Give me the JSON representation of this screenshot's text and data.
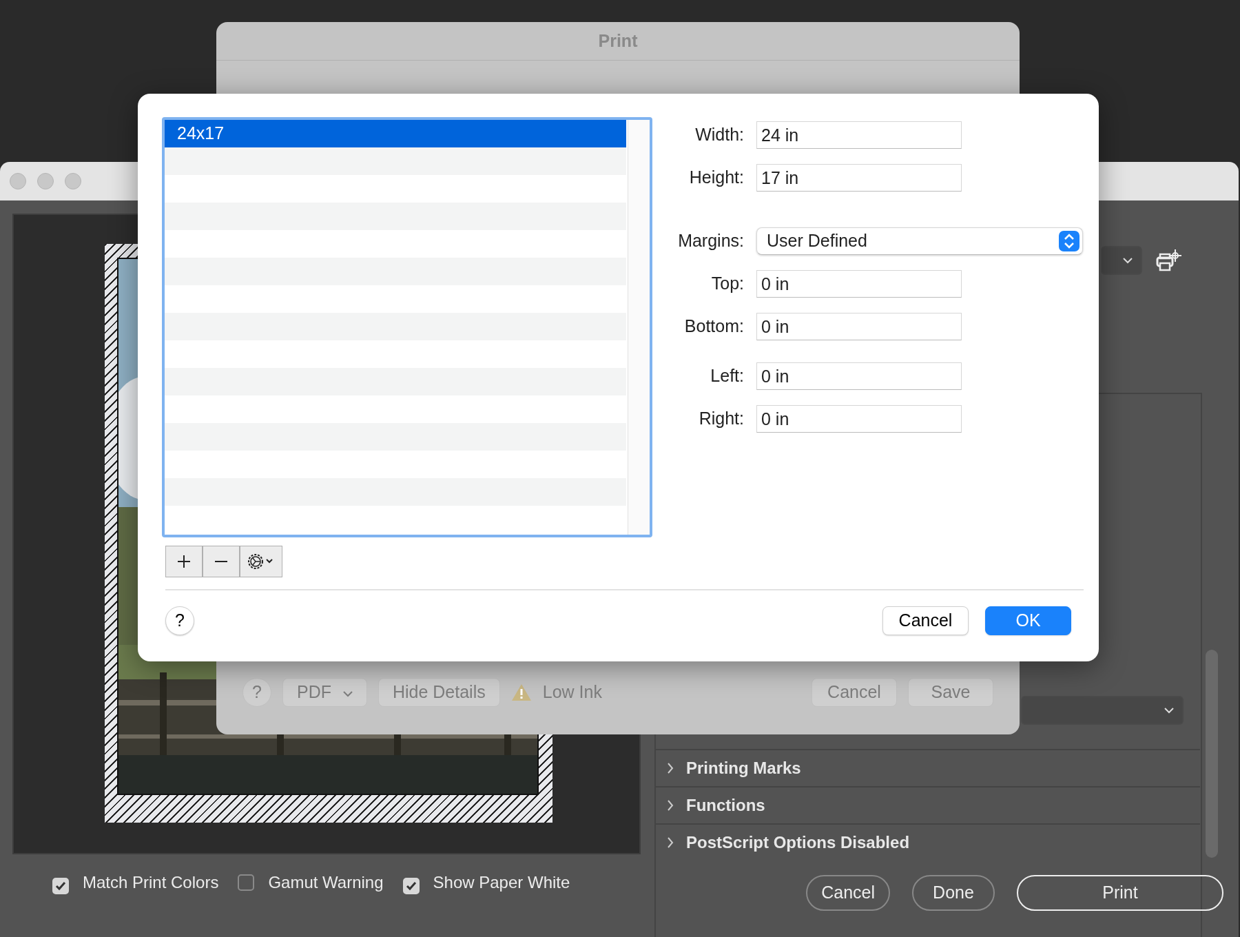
{
  "app_window": {
    "options": [
      {
        "label": "Match Print Colors",
        "checked": true
      },
      {
        "label": "Gamut Warning",
        "checked": false
      },
      {
        "label": "Show Paper White",
        "checked": true
      }
    ],
    "sections": [
      {
        "label": "Printing Marks",
        "expanded": false
      },
      {
        "label": "Functions",
        "expanded": false
      },
      {
        "label": "PostScript Options Disabled",
        "expanded": false
      }
    ],
    "buttons": [
      {
        "label": "Cancel",
        "kind": "secondary"
      },
      {
        "label": "Done",
        "kind": "secondary"
      },
      {
        "label": "Print",
        "kind": "default"
      }
    ]
  },
  "print_sheet": {
    "title": "Print",
    "help": "?",
    "pdf_button": "PDF",
    "details_button": "Hide Details",
    "warning": "Low Ink",
    "buttons": [
      "Cancel",
      "Save"
    ]
  },
  "paper_sheet": {
    "sizes": [
      {
        "label": "24x17",
        "selected": true
      }
    ],
    "fields": [
      {
        "label": "Width:",
        "value": "24 in"
      },
      {
        "label": "Height:",
        "value": "17 in"
      }
    ],
    "margins": {
      "label": "Margins:",
      "value": "User Defined"
    },
    "margin_fields": [
      {
        "label": "Top:",
        "value": "0 in"
      },
      {
        "label": "Bottom:",
        "value": "0 in"
      },
      {
        "label": "Left:",
        "value": "0 in"
      },
      {
        "label": "Right:",
        "value": "0 in"
      }
    ],
    "help": "?",
    "buttons": [
      {
        "label": "Cancel",
        "kind": "secondary"
      },
      {
        "label": "OK",
        "kind": "default"
      }
    ]
  }
}
